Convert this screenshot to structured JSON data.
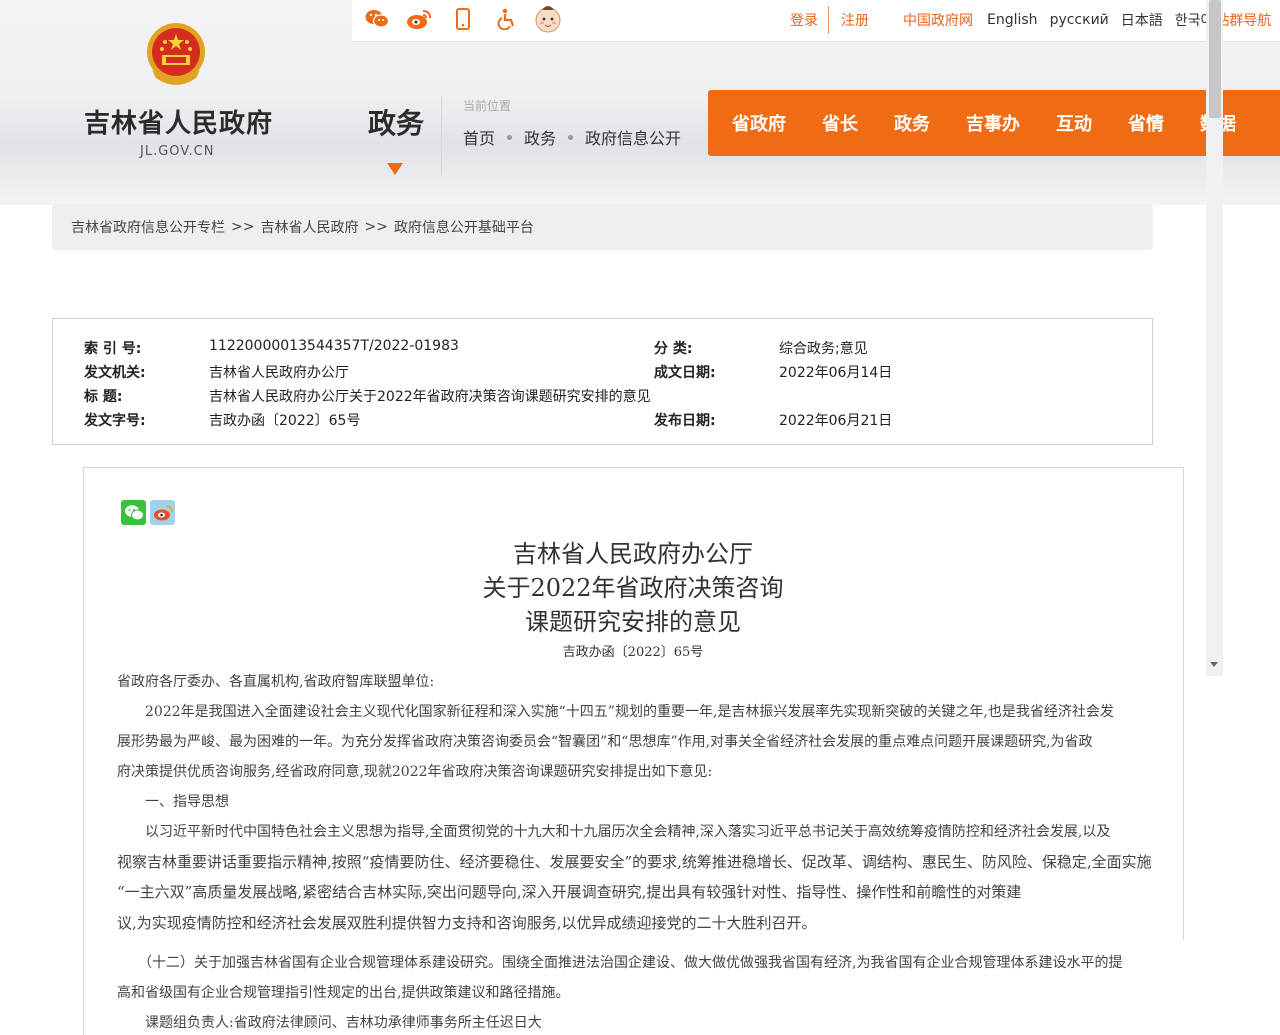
{
  "header": {
    "site_name": "吉林省人民政府",
    "site_domain": "JL.GOV.CN",
    "section_title": "政务",
    "location_label": "当前位置",
    "location_crumbs": [
      "首页",
      "政务",
      "政府信息公开"
    ],
    "top_links": {
      "login": "登录",
      "register": "注册",
      "gov_portal": "中国政府网",
      "english": "English",
      "russian": "русский",
      "japanese": "日本語",
      "korean": "한국어",
      "site_nav": "站群导航"
    },
    "nav_items": [
      "省政府",
      "省长",
      "政务",
      "吉事办",
      "互动",
      "省情",
      "数据"
    ]
  },
  "breadcrumb": [
    "吉林省政府信息公开专栏",
    "吉林省人民政府",
    "政府信息公开基础平台"
  ],
  "breadcrumb_sep": ">>",
  "meta": {
    "index_label": "索 引 号:",
    "index_value": "11220000013544357T/2022-01983",
    "category_label": "分 类:",
    "category_value": "综合政务;意见",
    "issuer_label": "发文机关:",
    "issuer_value": "吉林省人民政府办公厅",
    "date_label": "成文日期:",
    "date_value": "2022年06月14日",
    "title_label": "标 题:",
    "title_value": "吉林省人民政府办公厅关于2022年省政府决策咨询课题研究安排的意见",
    "docno_label": "发文字号:",
    "docno_value": "吉政办函〔2022〕65号",
    "publish_label": "发布日期:",
    "publish_value": "2022年06月21日"
  },
  "article": {
    "title_lines": [
      "吉林省人民政府办公厅",
      "关于2022年省政府决策咨询",
      "课题研究安排的意见"
    ],
    "doc_no": "吉政办函〔2022〕65号",
    "paragraphs": [
      "省政府各厅委办、各直属机构,省政府智库联盟单位:",
      "　　2022年是我国进入全面建设社会主义现代化国家新征程和深入实施“十四五”规划的重要一年,是吉林振兴发展率先实现新突破的关键之年,也是我省经济社会发",
      "展形势最为严峻、最为困难的一年。为充分发挥省政府决策咨询委员会“智囊团”和“思想库”作用,对事关全省经济社会发展的重点难点问题开展课题研究,为省政",
      "府决策提供优质咨询服务,经省政府同意,现就2022年省政府决策咨询课题研究安排提出如下意见:",
      "　　一、指导思想",
      "　　以习近平新时代中国特色社会主义思想为指导,全面贯彻党的十九大和十九届历次全会精神,深入落实习近平总书记关于高效统筹疫情防控和经济社会发展,以及",
      "视察吉林重要讲话重要指示精神,按照“疫情要防住、经济要稳住、发展要安全”的要求,统筹推进稳增长、促改革、调结构、惠民生、防风险、保稳定,全面实施",
      "“一主六双”高质量发展战略,紧密结合吉林实际,突出问题导向,深入开展调查研究,提出具有较强针对性、指导性、操作性和前瞻性的对策建",
      "议,为实现疫情防控和经济社会发展双胜利提供智力支持和咨询服务,以优异成绩迎接党的二十大胜利召开。",
      "　　（十二）关于加强吉林省国有企业合规管理体系建设研究。围绕全面推进法治国企建设、做大做优做强我省国有经济,为我省国有企业合规管理体系建设水平的提",
      "高和省级国有企业合规管理指引性规定的出台,提供政策建议和路径措施。",
      "　　课题组负责人:省政府法律顾问、吉林功承律师事务所主任迟日大"
    ]
  },
  "colors": {
    "accent": "#f06c14",
    "link_orange": "#e8651e",
    "wechat": "#3dc13a",
    "weibo": "#9fd3e7"
  },
  "icons": [
    "wechat-icon",
    "weibo-icon",
    "mobile-icon",
    "accessibility-icon",
    "mascot-icon",
    "emblem-icon",
    "share-wechat-icon",
    "share-weibo-icon"
  ]
}
